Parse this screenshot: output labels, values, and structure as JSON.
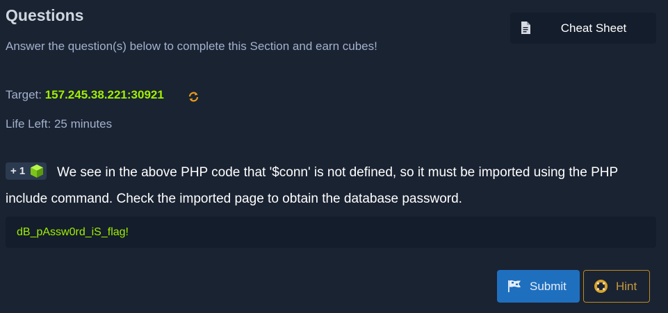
{
  "header": {
    "title": "Questions",
    "subtitle": "Answer the question(s) below to complete this Section and earn cubes!"
  },
  "cheat_sheet": {
    "label": "Cheat Sheet",
    "icon": "document-icon"
  },
  "target": {
    "label": "Target:",
    "value": "157.245.38.221:30921",
    "icon": "refresh-icon"
  },
  "life_left": {
    "label": "Life Left:",
    "value": "25 minutes"
  },
  "question": {
    "reward": "+ 1",
    "reward_icon": "cube-icon",
    "text": "We see in the above PHP code that '$conn' is not defined, so it must be imported using the PHP include command. Check the imported page to obtain the database password.",
    "answer": "dB_pAssw0rd_iS_flag!"
  },
  "actions": {
    "submit_label": "Submit",
    "submit_icon": "flag-icon",
    "hint_label": "Hint",
    "hint_icon": "lifebuoy-icon"
  },
  "colors": {
    "background": "#1a2332",
    "accent_green": "#9fef00",
    "submit_blue": "#1f6fbf",
    "hint_orange": "#c08a1a"
  }
}
